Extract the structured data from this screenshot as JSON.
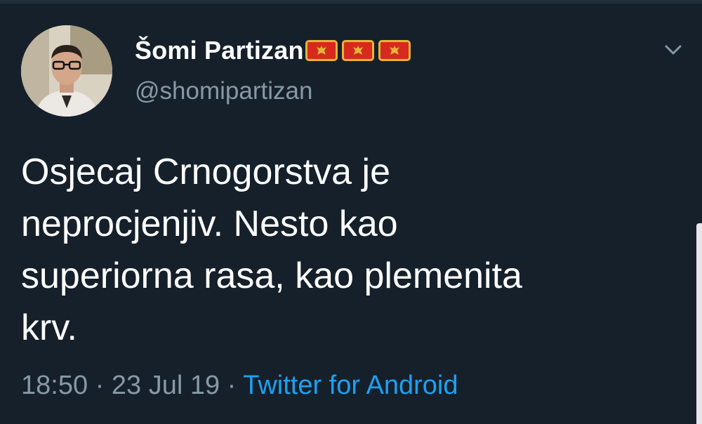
{
  "tweet": {
    "author": {
      "display_name": "Šomi Partizan",
      "handle": "@shomipartizan",
      "flag_emojis": [
        "flag-montenegro",
        "flag-montenegro",
        "flag-montenegro"
      ]
    },
    "text_lines": [
      "Osjecaj Crnogorstva je",
      "neprocjenjiv. Nesto kao",
      "superiorna rasa, kao plemenita",
      "krv."
    ],
    "time": "18:50",
    "separator": "·",
    "date": "23 Jul 19",
    "source": "Twitter for Android"
  },
  "icons": {
    "menu": "chevron-down-icon"
  },
  "colors": {
    "background": "#15202b",
    "text": "#ffffff",
    "secondary_text": "#8899a6",
    "link": "#1da1f2",
    "flag_red": "#d62a1e",
    "flag_gold": "#e5b43a"
  }
}
